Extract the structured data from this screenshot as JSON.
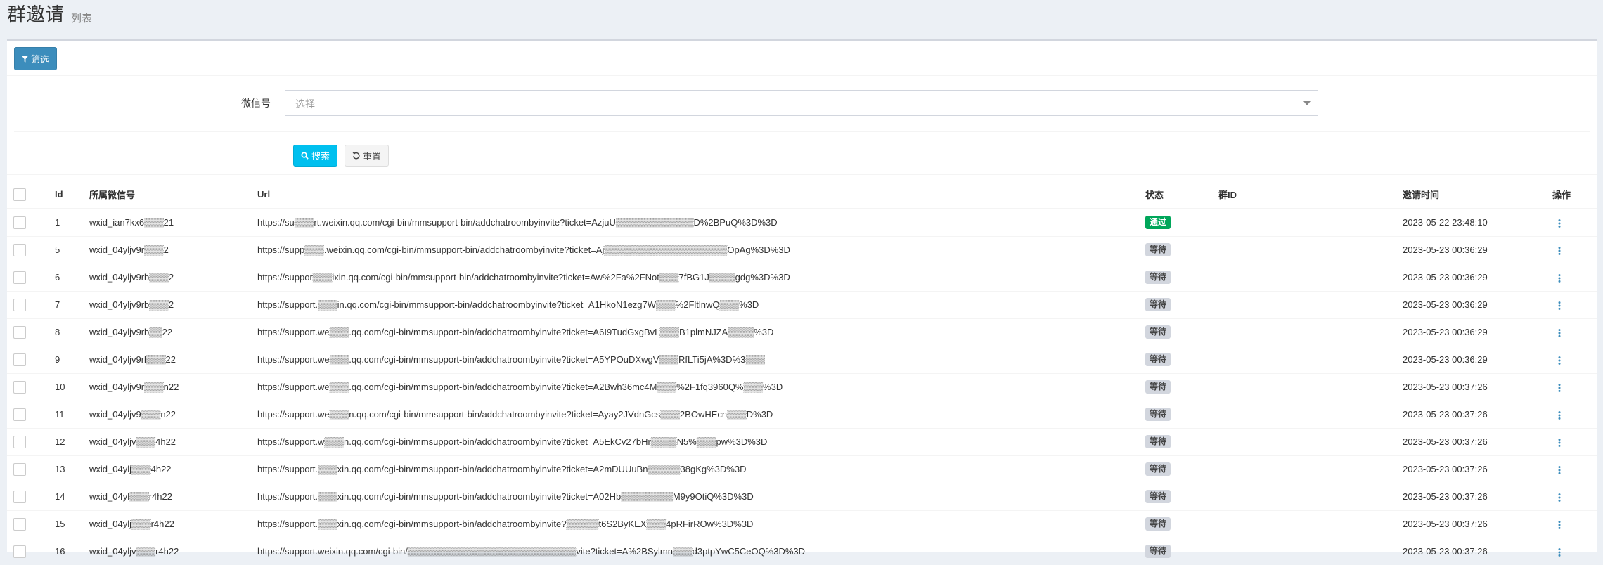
{
  "header": {
    "title": "群邀请",
    "subtitle": "列表"
  },
  "toolbar": {
    "filter_label": "筛选"
  },
  "filter": {
    "wechat_label": "微信号",
    "wechat_placeholder": "选择",
    "search_label": "搜索",
    "reset_label": "重置"
  },
  "table": {
    "columns": [
      "Id",
      "所属微信号",
      "Url",
      "状态",
      "群ID",
      "邀请时间",
      "操作"
    ],
    "rows": [
      {
        "id": "1",
        "wechat": "wxid_ian7kx6▒▒▒21",
        "url": "https://su▒▒▒rt.weixin.qq.com/cgi-bin/mmsupport-bin/addchatroombyinvite?ticket=AzjuU▒▒▒▒▒▒▒▒▒▒▒▒D%2BPuQ%3D%3D",
        "status": "通过",
        "status_type": "pass",
        "group_id": "",
        "time": "2023-05-22 23:48:10"
      },
      {
        "id": "5",
        "wechat": "wxid_04yljv9r▒▒▒2",
        "url": "https://supp▒▒▒.weixin.qq.com/cgi-bin/mmsupport-bin/addchatroombyinvite?ticket=Aj▒▒▒▒▒▒▒▒▒▒▒▒▒▒▒▒▒▒▒OpAg%3D%3D",
        "status": "等待",
        "status_type": "wait",
        "group_id": "",
        "time": "2023-05-23 00:36:29"
      },
      {
        "id": "6",
        "wechat": "wxid_04yljv9rb▒▒▒2",
        "url": "https://suppor▒▒▒ixin.qq.com/cgi-bin/mmsupport-bin/addchatroombyinvite?ticket=Aw%2Fa%2FNot▒▒▒7fBG1J▒▒▒▒gdg%3D%3D",
        "status": "等待",
        "status_type": "wait",
        "group_id": "",
        "time": "2023-05-23 00:36:29"
      },
      {
        "id": "7",
        "wechat": "wxid_04yljv9rb▒▒▒2",
        "url": "https://support.▒▒▒in.qq.com/cgi-bin/mmsupport-bin/addchatroombyinvite?ticket=A1HkoN1ezg7W▒▒▒%2FltlnwQ▒▒▒%3D",
        "status": "等待",
        "status_type": "wait",
        "group_id": "",
        "time": "2023-05-23 00:36:29"
      },
      {
        "id": "8",
        "wechat": "wxid_04yljv9rb▒▒22",
        "url": "https://support.we▒▒▒.qq.com/cgi-bin/mmsupport-bin/addchatroombyinvite?ticket=A6I9TudGxgBvL▒▒▒B1plmNJZA▒▒▒▒%3D",
        "status": "等待",
        "status_type": "wait",
        "group_id": "",
        "time": "2023-05-23 00:36:29"
      },
      {
        "id": "9",
        "wechat": "wxid_04yljv9rl▒▒▒22",
        "url": "https://support.we▒▒▒.qq.com/cgi-bin/mmsupport-bin/addchatroombyinvite?ticket=A5YPOuDXwgV▒▒▒RfLTi5jA%3D%3▒▒▒",
        "status": "等待",
        "status_type": "wait",
        "group_id": "",
        "time": "2023-05-23 00:36:29"
      },
      {
        "id": "10",
        "wechat": "wxid_04yljv9r▒▒▒n22",
        "url": "https://support.we▒▒▒.qq.com/cgi-bin/mmsupport-bin/addchatroombyinvite?ticket=A2Bwh36mc4M▒▒▒%2F1fq3960Q%▒▒▒%3D",
        "status": "等待",
        "status_type": "wait",
        "group_id": "",
        "time": "2023-05-23 00:37:26"
      },
      {
        "id": "11",
        "wechat": "wxid_04yljv9▒▒▒n22",
        "url": "https://support.we▒▒▒n.qq.com/cgi-bin/mmsupport-bin/addchatroombyinvite?ticket=Ayay2JVdnGcs▒▒▒2BOwHEcn▒▒▒D%3D",
        "status": "等待",
        "status_type": "wait",
        "group_id": "",
        "time": "2023-05-23 00:37:26"
      },
      {
        "id": "12",
        "wechat": "wxid_04yljv▒▒▒4h22",
        "url": "https://support.w▒▒▒n.qq.com/cgi-bin/mmsupport-bin/addchatroombyinvite?ticket=A5EkCv27bHr▒▒▒▒N5%▒▒▒pw%3D%3D",
        "status": "等待",
        "status_type": "wait",
        "group_id": "",
        "time": "2023-05-23 00:37:26"
      },
      {
        "id": "13",
        "wechat": "wxid_04ylj▒▒▒4h22",
        "url": "https://support.▒▒▒xin.qq.com/cgi-bin/mmsupport-bin/addchatroombyinvite?ticket=A2mDUUuBn▒▒▒▒▒38gKg%3D%3D",
        "status": "等待",
        "status_type": "wait",
        "group_id": "",
        "time": "2023-05-23 00:37:26"
      },
      {
        "id": "14",
        "wechat": "wxid_04yl▒▒▒r4h22",
        "url": "https://support.▒▒▒xin.qq.com/cgi-bin/mmsupport-bin/addchatroombyinvite?ticket=A02Hb▒▒▒▒▒▒▒▒M9y9OtiQ%3D%3D",
        "status": "等待",
        "status_type": "wait",
        "group_id": "",
        "time": "2023-05-23 00:37:26"
      },
      {
        "id": "15",
        "wechat": "wxid_04ylj▒▒▒r4h22",
        "url": "https://support.▒▒▒xin.qq.com/cgi-bin/mmsupport-bin/addchatroombyinvite?▒▒▒▒▒t6S2ByKEX▒▒▒4pRFirROw%3D%3D",
        "status": "等待",
        "status_type": "wait",
        "group_id": "",
        "time": "2023-05-23 00:37:26"
      },
      {
        "id": "16",
        "wechat": "wxid_04yljv▒▒▒r4h22",
        "url": "https://support.weixin.qq.com/cgi-bin/▒▒▒▒▒▒▒▒▒▒▒▒▒▒▒▒▒▒▒▒▒▒▒▒▒▒vite?ticket=A%2BSylmn▒▒▒d3ptpYwC5CeOQ%3D%3D",
        "status": "等待",
        "status_type": "wait",
        "group_id": "",
        "time": "2023-05-23 00:37:26"
      }
    ]
  },
  "colors": {
    "primary": "#3c8dbc",
    "info": "#00c0ef",
    "success": "#00a65a",
    "default_badge": "#d2d6de"
  },
  "icons": {
    "filter": "filter-icon",
    "search": "search-icon",
    "reset": "undo-icon",
    "row_action": "vertical-ellipsis-icon"
  }
}
